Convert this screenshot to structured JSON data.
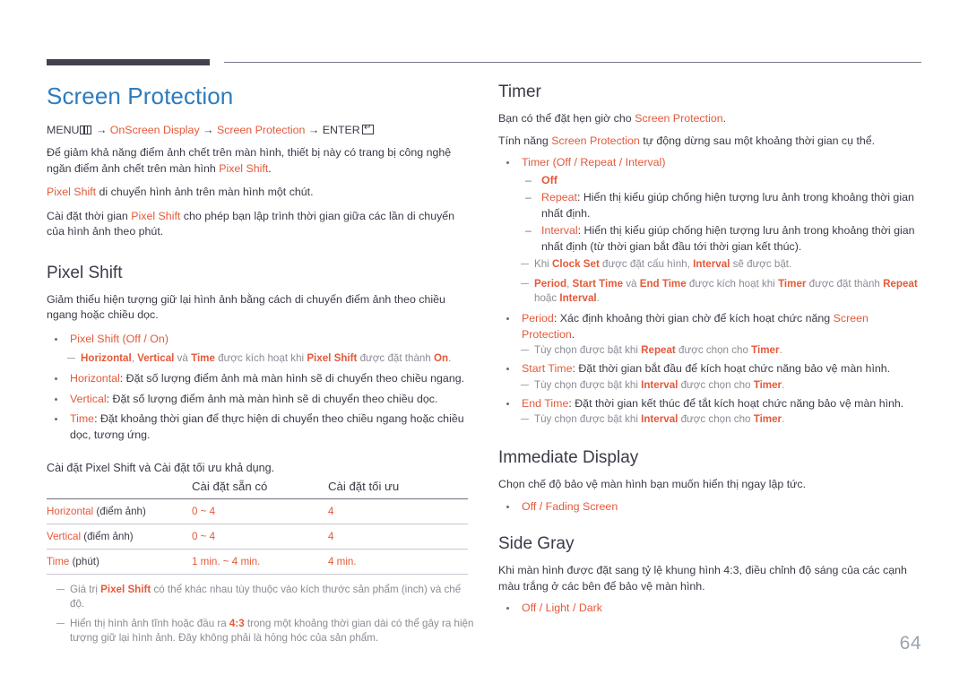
{
  "page": {
    "number": "64",
    "title": "Screen Protection"
  },
  "menu_path": {
    "menu_label": "MENU",
    "menu_icon": "menu-grid-icon",
    "arrow": "→",
    "item1": "OnScreen Display",
    "item2": "Screen Protection",
    "enter_label": "ENTER",
    "enter_icon": "enter-return-icon"
  },
  "left": {
    "intro1_a": "Để giảm khả năng điểm ảnh chết trên màn hình, thiết bị này có trang bị công nghệ ngăn điểm ảnh chết trên màn hình ",
    "intro1_hl": "Pixel Shift",
    "intro1_b": ".",
    "intro2_hl": "Pixel Shift",
    "intro2_a": " di chuyển hình ảnh trên màn hình một chút.",
    "intro3_a": "Cài đặt thời gian ",
    "intro3_hl": "Pixel Shift",
    "intro3_b": " cho phép bạn lập trình thời gian giữa các lần di chuyển của hình ảnh theo phút.",
    "pixel_shift": {
      "heading": "Pixel Shift",
      "desc": "Giảm thiểu hiện tượng giữ lại hình ảnh bằng cách di chuyển điểm ảnh theo chiều ngang hoặc chiều dọc.",
      "b1_name": "Pixel Shift",
      "b1_opts": " (Off / On)",
      "b1_opt_off": "Off",
      "b1_opt_on": "On",
      "note1_a": "Horizontal",
      "note1_b": ", ",
      "note1_c": "Vertical",
      "note1_d": " và ",
      "note1_e": "Time",
      "note1_f": " được kích hoạt khi ",
      "note1_g": "Pixel Shift",
      "note1_h": " được đặt thành ",
      "note1_i": "On",
      "note1_j": ".",
      "b2_name": "Horizontal",
      "b2_text": ": Đặt số lượng điểm ảnh mà màn hình sẽ di chuyển theo chiều ngang.",
      "b3_name": "Vertical",
      "b3_text": ": Đặt số lượng điểm ảnh mà màn hình sẽ di chuyển theo chiều dọc.",
      "b4_name": "Time",
      "b4_text": ": Đặt khoảng thời gian để thực hiện di chuyển theo chiều ngang hoặc chiều dọc, tương ứng."
    },
    "table": {
      "lead_a": "Cài đặt ",
      "lead_hl": "Pixel Shift",
      "lead_b": " và Cài đặt tối ưu khả dụng.",
      "headers": [
        "",
        "Cài đặt sẵn có",
        "Cài đặt tối ưu"
      ],
      "rows": [
        {
          "name": "Horizontal",
          "unit": " (điểm ảnh)",
          "available": "0 ~ 4",
          "optimum": "4"
        },
        {
          "name": "Vertical",
          "unit": " (điểm ảnh)",
          "available": "0 ~ 4",
          "optimum": "4"
        },
        {
          "name": "Time",
          "unit": " (phút)",
          "available": "1 min. ~ 4 min.",
          "optimum": "4 min."
        }
      ],
      "note1_a": "Giá trị ",
      "note1_hl": "Pixel Shift",
      "note1_b": " có thể khác nhau tùy thuộc vào kích thước sản phẩm (inch) và chế độ.",
      "note2_a": "Hiển thị hình ảnh tĩnh hoặc đầu ra ",
      "note2_hl": "4:3",
      "note2_b": " trong một khoảng thời gian dài có thể gây ra hiện tượng giữ lại hình ảnh. Đây không phải là hỏng hóc của sản phẩm."
    }
  },
  "right": {
    "timer": {
      "heading": "Timer",
      "p1_a": "Bạn có thể đặt hẹn giờ cho ",
      "p1_hl": "Screen Protection",
      "p1_b": ".",
      "p2_a": "Tính năng ",
      "p2_hl": "Screen Protection",
      "p2_b": " tự động dừng sau một khoảng thời gian cụ thể.",
      "b1_name": "Timer",
      "b1_opts": " (Off / Repeat / Interval)",
      "sub_off": "Off",
      "sub_repeat_name": "Repeat",
      "sub_repeat_text": ": Hiển thị kiểu giúp chống hiện tượng lưu ảnh trong khoảng thời gian nhất định.",
      "sub_interval_name": "Interval",
      "sub_interval_text": ": Hiển thị kiểu giúp chống hiện tượng lưu ảnh trong khoảng thời gian nhất định (từ thời gian bắt đầu tới thời gian kết thúc).",
      "note_clock_a": "Khi ",
      "note_clock_hl1": "Clock Set",
      "note_clock_b": " được đặt cấu hình, ",
      "note_clock_hl2": "Interval",
      "note_clock_c": " sẽ được bật.",
      "note_period_hl1": "Period",
      "note_period_a": ", ",
      "note_period_hl2": "Start Time",
      "note_period_b": " và ",
      "note_period_hl3": "End Time",
      "note_period_c": " được kích hoạt khi ",
      "note_period_hl4": "Timer",
      "note_period_d": " được đặt thành ",
      "note_period_hl5": "Repeat",
      "note_period_e": " hoặc ",
      "note_period_hl6": "Interval",
      "note_period_f": ".",
      "b_period_name": "Period",
      "b_period_a": ": Xác định khoảng thời gian chờ để kích hoạt chức năng ",
      "b_period_hl": "Screen Protection",
      "b_period_b": ".",
      "note_period2_a": "Tùy chọn được bật khi ",
      "note_period2_hl1": "Repeat",
      "note_period2_b": " được chọn cho ",
      "note_period2_hl2": "Timer",
      "note_period2_c": ".",
      "b_start_name": "Start Time",
      "b_start_text": ": Đặt thời gian bắt đầu để kích hoạt chức năng bảo vệ màn hình.",
      "note_start_a": "Tùy chọn được bật khi ",
      "note_start_hl1": "Interval",
      "note_start_b": " được chọn cho ",
      "note_start_hl2": "Timer",
      "note_start_c": ".",
      "b_end_name": "End Time",
      "b_end_text": ": Đặt thời gian kết thúc để tắt kích hoạt chức năng bảo vệ màn hình.",
      "note_end_a": "Tùy chọn được bật khi ",
      "note_end_hl1": "Interval",
      "note_end_b": " được chọn cho ",
      "note_end_hl2": "Timer",
      "note_end_c": "."
    },
    "immediate_display": {
      "heading": "Immediate Display",
      "desc": "Chọn chế độ bảo vệ màn hình bạn muốn hiển thị ngay lập tức.",
      "opts": "Off / Fading Screen"
    },
    "side_gray": {
      "heading": "Side Gray",
      "desc": "Khi màn hình được đặt sang tỷ lệ khung hình 4:3, điều chỉnh độ sáng của các cạnh màu trắng ở các bên để bảo vệ màn hình.",
      "opts": "Off / Light / Dark"
    }
  },
  "colors": {
    "accent_orange": "#e4593a",
    "title_blue": "#2d7cbd",
    "text_dark": "#3d3a47",
    "note_gray": "#8d8a95",
    "page_num_gray": "#9aa4ad"
  }
}
